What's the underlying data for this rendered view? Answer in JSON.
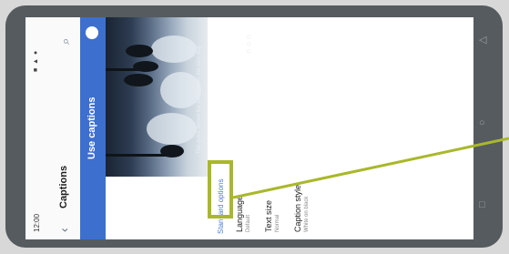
{
  "status_bar": {
    "time": "12:00",
    "icons": "■ ▲ ●"
  },
  "app_bar": {
    "title": "Captions",
    "back_icon": "back-arrow-icon",
    "search_icon": "search-icon"
  },
  "banner": {
    "title": "Use captions"
  },
  "photo": {
    "caption": "The quick brown fox jumps over the lazy dog"
  },
  "settings": {
    "section_header": "Standard options",
    "items": [
      {
        "label": "Language",
        "sub": "Default"
      },
      {
        "label": "Text size",
        "sub": "Normal"
      },
      {
        "label": "Caption style",
        "sub": "White on black"
      }
    ]
  },
  "nav_bar": {
    "back": "◁",
    "home": "○",
    "recents": "□"
  },
  "colors": {
    "accent": "#3d6fcf",
    "highlight": "#a9b82a",
    "bezel": "#555b5e"
  }
}
